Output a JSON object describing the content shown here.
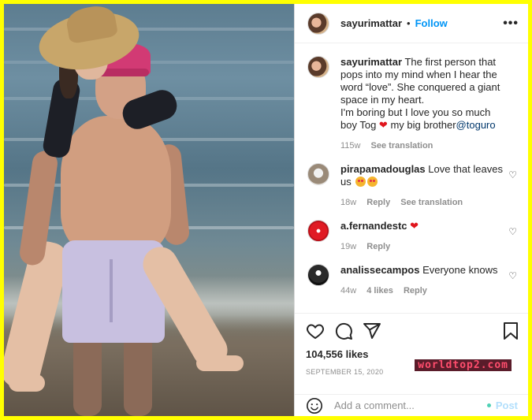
{
  "post": {
    "username": "sayurimattar",
    "follow_label": "Follow",
    "caption": "The first person that pops into my mind when I hear the word “love”. She conquered a giant space in my heart.",
    "caption_line2_pre": "I'm boring but I love you so much boy Tog",
    "caption_line2_post": "my big brother",
    "caption_mention": "@toguro",
    "caption_age": "115w",
    "see_translation": "See translation",
    "likes": "104,556 likes",
    "date": "SEPTEMBER 15, 2020"
  },
  "comments": [
    {
      "user": "pirapamadouglas",
      "text": "Love that leaves us",
      "age": "18w",
      "reply": "Reply",
      "see_translation": "See translation"
    },
    {
      "user": "a.fernandestc",
      "text": "",
      "age": "19w",
      "reply": "Reply"
    },
    {
      "user": "analissecampos",
      "text": "Everyone knows",
      "age": "44w",
      "likes": "4 likes",
      "reply": "Reply"
    }
  ],
  "add_comment": {
    "placeholder": "Add a comment...",
    "post_label": "Post"
  },
  "watermark": "worldtop2.com",
  "colors": {
    "accent": "#0095f6",
    "heart": "#e0151d",
    "frame": "#ffff00"
  }
}
